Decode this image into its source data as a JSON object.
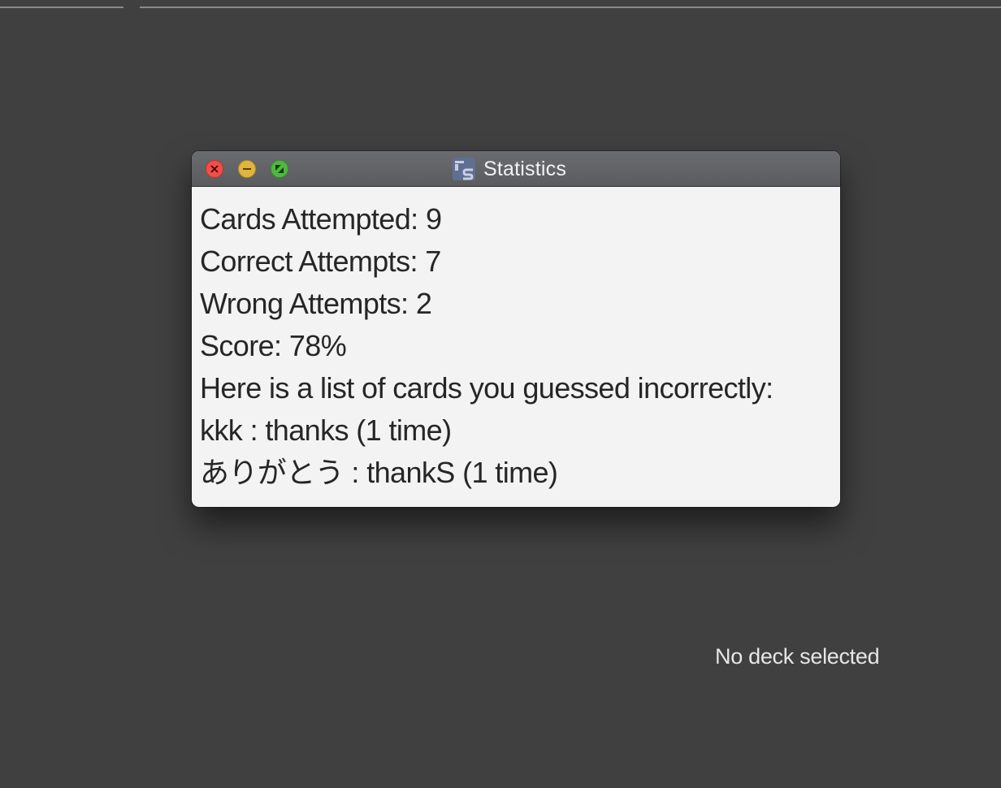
{
  "background": {
    "status_text": "No deck selected"
  },
  "window": {
    "title": "Statistics",
    "icon": "flashcards-app-icon",
    "controls": [
      "close",
      "minimize",
      "zoom"
    ]
  },
  "stats": {
    "cards_attempted": "Cards Attempted: 9",
    "correct_attempts": "Correct Attempts: 7",
    "wrong_attempts": "Wrong Attempts: 2",
    "score": "Score: 78%",
    "incorrect_header": "Here is a list of cards you guessed incorrectly:",
    "incorrect_cards": [
      "kkk : thanks (1 time)",
      "ありがとう : thankS (1 time)"
    ]
  },
  "colors": {
    "desktop_bg": "#404040",
    "window_bg": "#f3f3f3",
    "close": "#f04f49",
    "minimize": "#dfb53f",
    "zoom": "#4fb840"
  }
}
